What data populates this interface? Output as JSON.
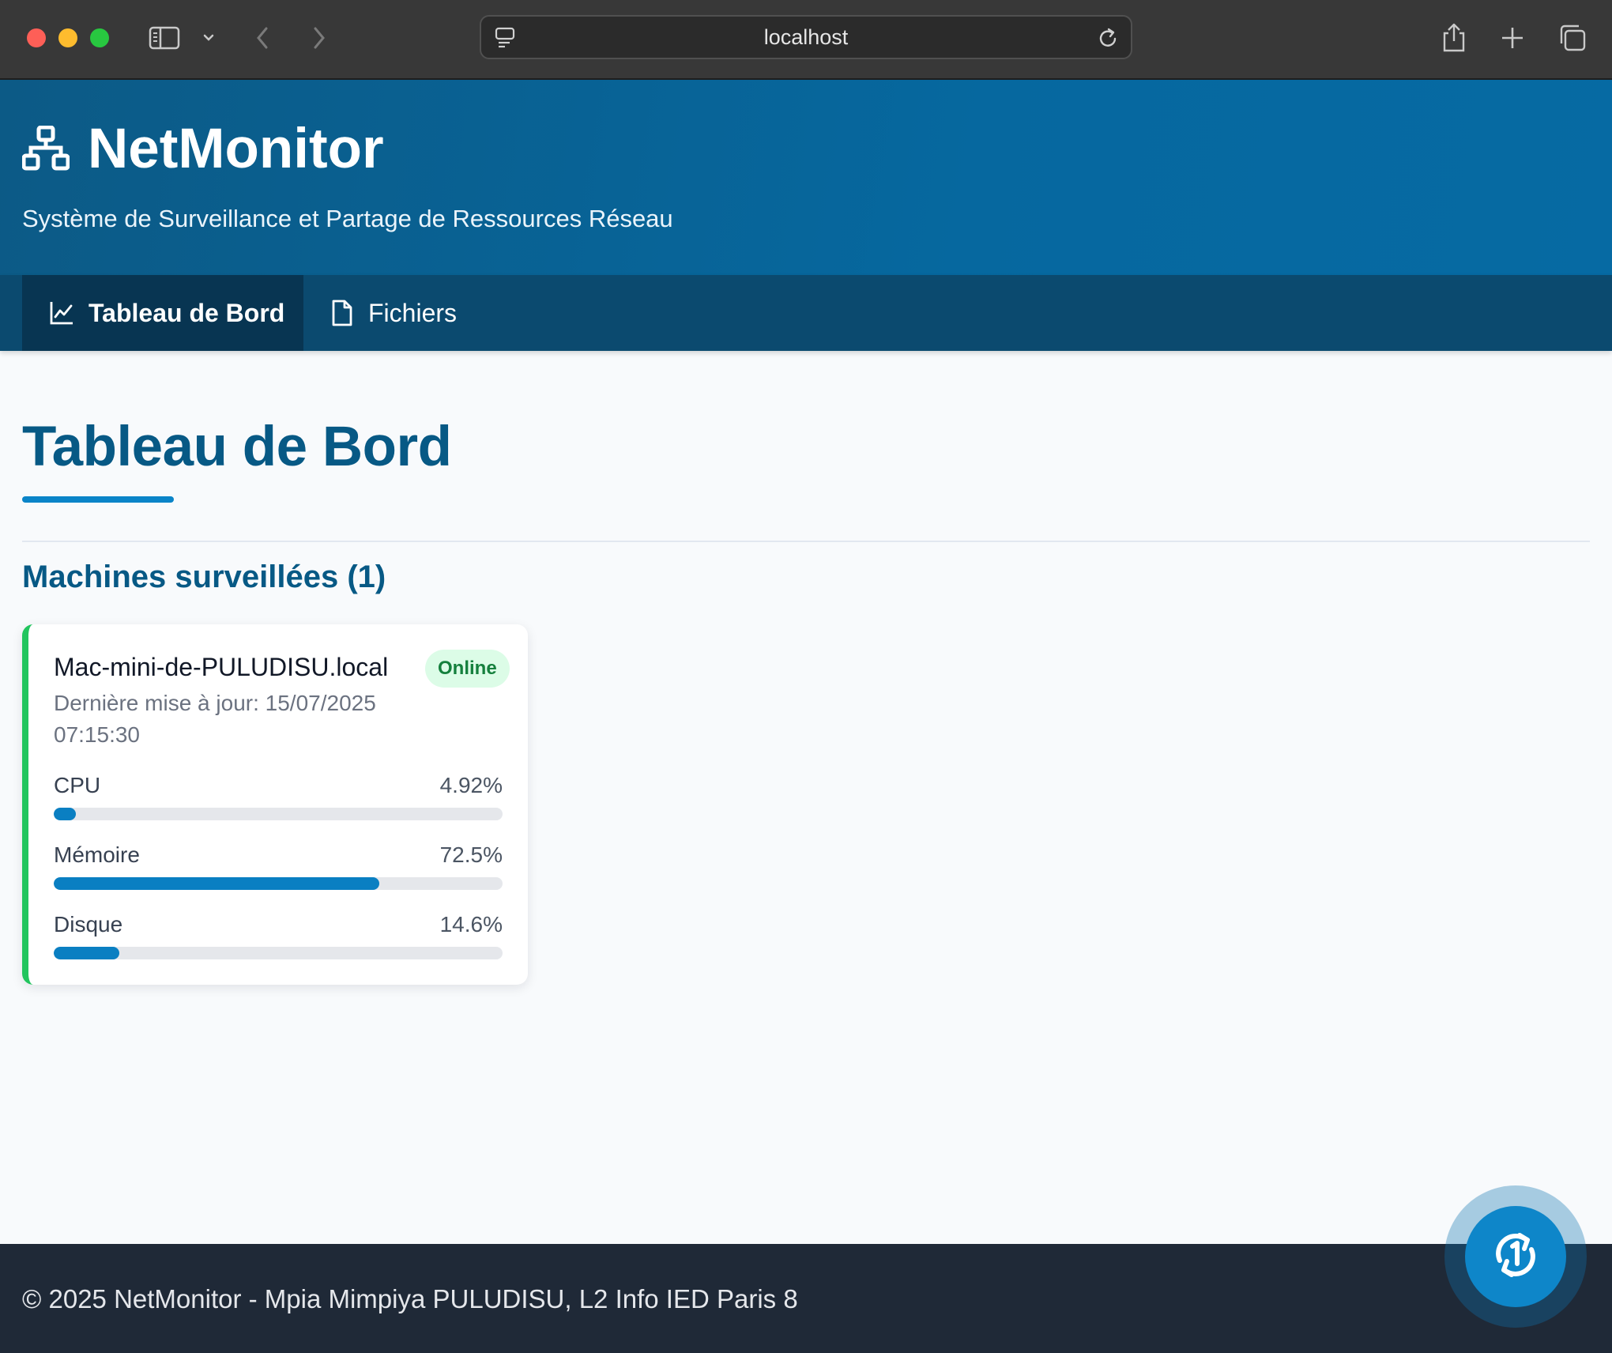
{
  "browser": {
    "url": "localhost"
  },
  "app": {
    "title": "NetMonitor",
    "subtitle": "Système de Surveillance et Partage de Ressources Réseau",
    "brand_icon": "network-icon"
  },
  "nav": {
    "tabs": [
      {
        "label": "Tableau de Bord",
        "icon": "chart-line-icon",
        "active": true
      },
      {
        "label": "Fichiers",
        "icon": "file-icon",
        "active": false
      }
    ]
  },
  "main": {
    "page_title": "Tableau de Bord",
    "section_title": "Machines surveillées (1)",
    "machines": [
      {
        "hostname": "Mac-mini-de-PULUDISU.local",
        "status": "Online",
        "last_update": "Dernière mise à jour: 15/07/2025 07:15:30",
        "metrics": [
          {
            "label": "CPU",
            "value_text": "4.92%",
            "value": 4.92
          },
          {
            "label": "Mémoire",
            "value_text": "72.5%",
            "value": 72.5
          },
          {
            "label": "Disque",
            "value_text": "14.6%",
            "value": 14.6
          }
        ]
      }
    ]
  },
  "footer": {
    "text": "© 2025 NetMonitor - Mpia Mimpiya PULUDISU, L2 Info IED Paris 8"
  },
  "colors": {
    "header": "#06689f",
    "nav": "#0b4a6f",
    "nav_active": "#083552",
    "accent": "#0a7fc2",
    "online": "#22c55e",
    "footer": "#1f2937"
  },
  "fab": {
    "icon": "refresh-icon"
  }
}
